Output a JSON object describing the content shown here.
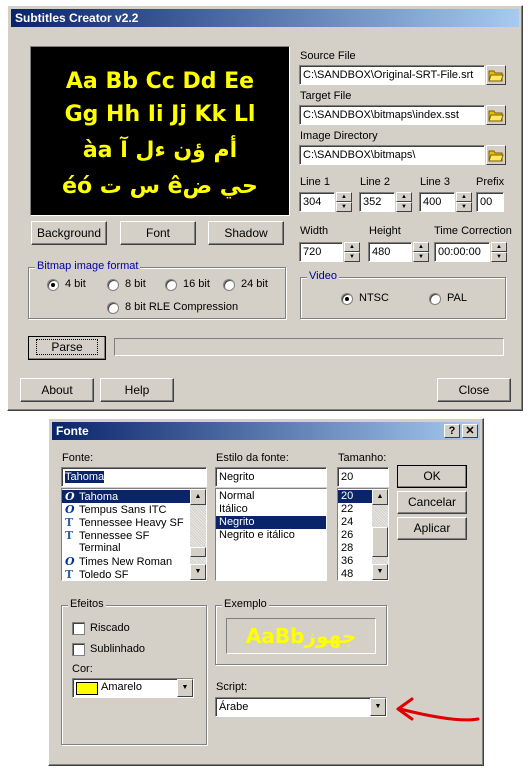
{
  "main_window": {
    "title": "Subtitles Creator v2.2",
    "preview": {
      "lines": [
        "Aa Bb Cc Dd Ee",
        "Gg Hh Ii Jj Kk Ll",
        "أم ؤن ءل آ àa",
        "حي ضê س ت éó"
      ],
      "background": "#000000",
      "text_color": "#ffff00"
    },
    "source_file": {
      "label": "Source File",
      "value": "C:\\SANDBOX\\Original-SRT-File.srt"
    },
    "target_file": {
      "label": "Target File",
      "value": "C:\\SANDBOX\\bitmaps\\index.sst"
    },
    "image_directory": {
      "label": "Image Directory",
      "value": "C:\\SANDBOX\\bitmaps\\"
    },
    "line1": {
      "label": "Line 1",
      "value": "304"
    },
    "line2": {
      "label": "Line 2",
      "value": "352"
    },
    "line3": {
      "label": "Line 3",
      "value": "400"
    },
    "prefix": {
      "label": "Prefix",
      "value": "00"
    },
    "width": {
      "label": "Width",
      "value": "720"
    },
    "height": {
      "label": "Height",
      "value": "480"
    },
    "time_correction": {
      "label": "Time Correction",
      "value": "00:00:00"
    },
    "buttons": {
      "background": "Background",
      "font": "Font",
      "shadow": "Shadow",
      "parse": "Parse",
      "about": "About",
      "help": "Help",
      "close": "Close"
    },
    "bitmap_format": {
      "label": "Bitmap image format",
      "options": [
        "4 bit",
        "8 bit",
        "16 bit",
        "24 bit",
        "8 bit RLE Compression"
      ],
      "selected": "4 bit"
    },
    "video": {
      "label": "Video",
      "options": [
        "NTSC",
        "PAL"
      ],
      "selected": "NTSC"
    }
  },
  "font_dialog": {
    "title": "Fonte",
    "font_label": "Fonte:",
    "font_value": "Tahoma",
    "fonts": [
      {
        "name": "Tahoma",
        "icon": "opentype-icon",
        "selected": true
      },
      {
        "name": "Tempus Sans ITC",
        "icon": "opentype-icon"
      },
      {
        "name": "Tennessee Heavy SF",
        "icon": "truetype-icon"
      },
      {
        "name": "Tennessee SF",
        "icon": "truetype-icon"
      },
      {
        "name": "Terminal",
        "icon": ""
      },
      {
        "name": "Times New Roman",
        "icon": "opentype-icon"
      },
      {
        "name": "Toledo SF",
        "icon": "truetype-icon"
      }
    ],
    "style_label": "Estilo da fonte:",
    "style_value": "Negrito",
    "styles": [
      {
        "name": "Normal"
      },
      {
        "name": "Itálico"
      },
      {
        "name": "Negrito",
        "selected": true
      },
      {
        "name": "Negrito e itálico"
      }
    ],
    "size_label": "Tamanho:",
    "size_value": "20",
    "sizes": [
      {
        "name": "20",
        "selected": true
      },
      {
        "name": "22"
      },
      {
        "name": "24"
      },
      {
        "name": "26"
      },
      {
        "name": "28"
      },
      {
        "name": "36"
      },
      {
        "name": "48"
      }
    ],
    "buttons": {
      "ok": "OK",
      "cancel": "Cancelar",
      "apply": "Aplicar"
    },
    "effects": {
      "label": "Efeitos",
      "strikeout": "Riscado",
      "underline": "Sublinhado"
    },
    "color": {
      "label": "Cor:",
      "value": "Amarelo",
      "swatch": "#ffff00"
    },
    "sample": {
      "label": "Exemplo",
      "text": "AaBbجهوز"
    },
    "script": {
      "label": "Script:",
      "value": "Árabe"
    },
    "annotation_arrow_color": "#e00000"
  }
}
